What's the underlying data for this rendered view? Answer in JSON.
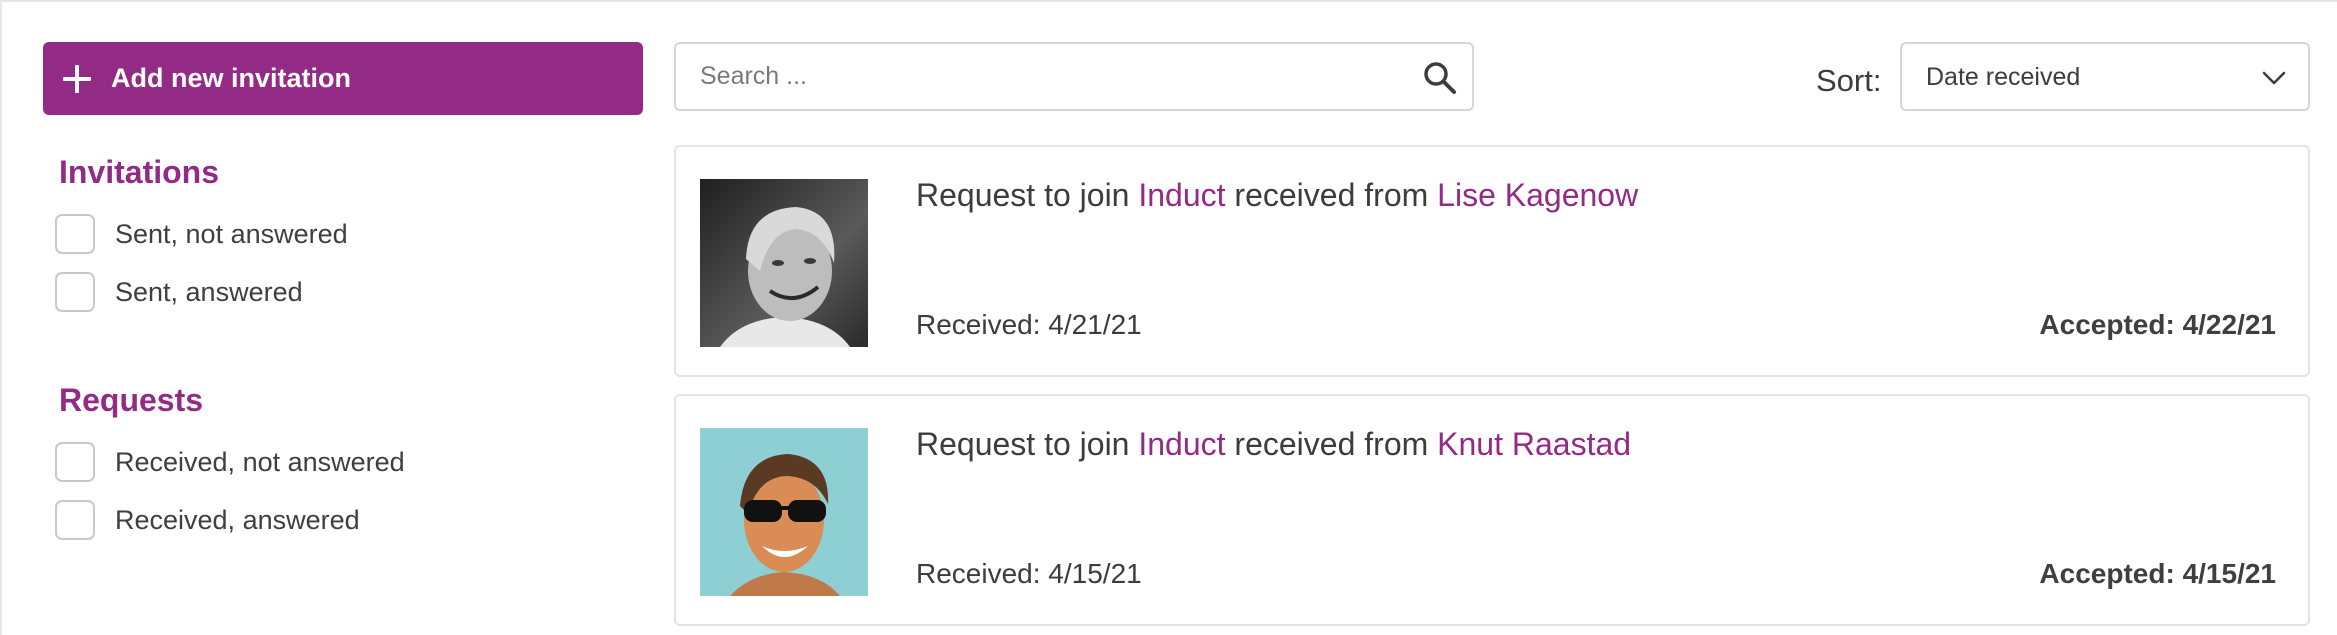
{
  "sidebar": {
    "add_button_label": "Add new invitation",
    "invitations": {
      "title": "Invitations",
      "options": [
        {
          "label": "Sent, not answered",
          "checked": false
        },
        {
          "label": "Sent, answered",
          "checked": false
        }
      ]
    },
    "requests": {
      "title": "Requests",
      "options": [
        {
          "label": "Received, not answered",
          "checked": false
        },
        {
          "label": "Received, answered",
          "checked": false
        }
      ]
    }
  },
  "search": {
    "placeholder": "Search ...",
    "value": ""
  },
  "sort": {
    "label": "Sort:",
    "selected": "Date received"
  },
  "cards": [
    {
      "prefix": "Request to join",
      "group": "Induct",
      "middle": "received from",
      "person": "Lise Kagenow",
      "received": "Received: 4/21/21",
      "accepted": "Accepted: 4/22/21"
    },
    {
      "prefix": "Request to join",
      "group": "Induct",
      "middle": "received from",
      "person": "Knut Raastad",
      "received": "Received: 4/15/21",
      "accepted": "Accepted: 4/15/21"
    }
  ],
  "colors": {
    "accent": "#922a86",
    "text": "#3c3c3c",
    "border": "#d6d6d6"
  }
}
